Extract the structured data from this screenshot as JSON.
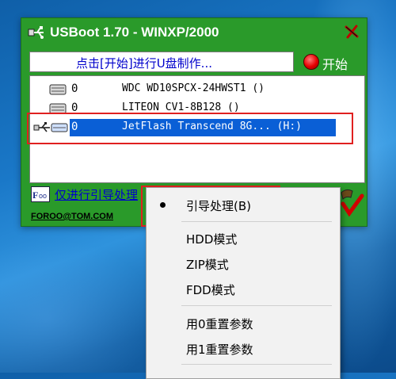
{
  "window": {
    "title": "USBoot 1.70 - WINXP/2000",
    "status_text": "点击[开始]进行U盘制作...",
    "start_label": "开始",
    "footer_link": "仅进行引导处理",
    "footer_email": "FOROO@TOM.COM"
  },
  "drives": [
    {
      "num": "0",
      "name": "WDC WD10SPCX-24HWST1 ()",
      "icon": "hard-disk-icon",
      "selected": false
    },
    {
      "num": "0",
      "name": "LITEON CV1-8B128 ()",
      "icon": "hard-disk-icon",
      "selected": false
    },
    {
      "num": "0",
      "name": "JetFlash Transcend 8G...  (H:)",
      "icon": "usb-drive-icon",
      "selected": true
    }
  ],
  "context_menu": {
    "items": [
      {
        "label": "引导处理(B)",
        "checked": true
      },
      {
        "label": "HDD模式",
        "checked": false
      },
      {
        "label": "ZIP模式",
        "checked": false
      },
      {
        "label": "FDD模式",
        "checked": false
      },
      {
        "label": "用0重置参数",
        "checked": false
      },
      {
        "label": "用1重置参数",
        "checked": false
      }
    ]
  },
  "colors": {
    "window_green": "#2a9a2a",
    "selection_blue": "#0a5fd6",
    "highlight_red": "#e02020",
    "link_blue": "#0000cc"
  }
}
